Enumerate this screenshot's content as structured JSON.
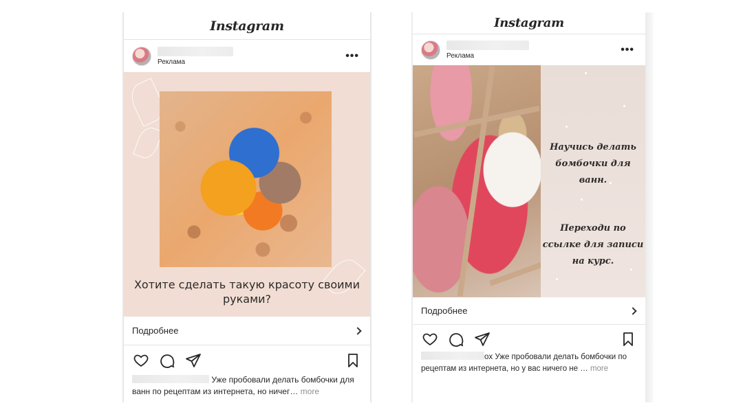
{
  "left_post": {
    "logo": "Instagram",
    "ad_label": "Реклама",
    "more_menu": "•••",
    "headline": "Хотите сделать такую красоту своими руками?",
    "cta_label": "Подробнее",
    "caption_text": " Уже пробовали делать бомбочки для ванн по рецептам из интернета, но ничег… ",
    "more_label": "more"
  },
  "right_post": {
    "logo": "Instagram",
    "ad_label": "Реклама",
    "more_menu": "•••",
    "script_line_1": "Научись делать бомбочки для ванн.",
    "script_line_2": "Переходи по ссылке для записи на курс.",
    "cta_label": "Подробнее",
    "caption_text": "ox Уже пробовали делать бомбочки по рецептам из интернета, но у вас ничего не … ",
    "more_label": "more"
  },
  "icons": [
    "heart-icon",
    "comment-icon",
    "share-icon",
    "bookmark-icon",
    "chevron-right-icon",
    "more-icon"
  ],
  "colors": {
    "left_bg": "#f1ddd3",
    "right_panel": "#e9ddd7",
    "text": "#262626",
    "muted": "#8e8e8e"
  }
}
